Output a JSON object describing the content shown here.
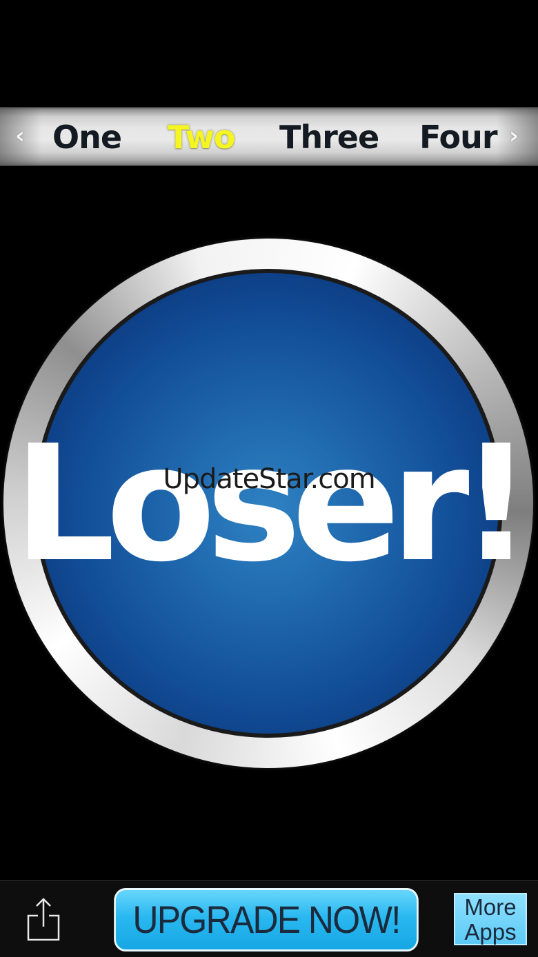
{
  "tabs": {
    "items": [
      "One",
      "Two",
      "Three",
      "Four"
    ],
    "selected_index": 1,
    "prev_arrow": "‹",
    "next_arrow": "›"
  },
  "main_button": {
    "label": "Loser!"
  },
  "watermark": "UpdateStar.com",
  "bottom_bar": {
    "share_icon": "share-icon",
    "upgrade_label": "UPGRADE NOW!",
    "more_apps_line1": "More",
    "more_apps_line2": "Apps"
  },
  "colors": {
    "selected_tab": "#f5f522",
    "tab_text": "#141a22",
    "button_face": "#1f67ad",
    "upgrade_button": "#2ab8f0"
  }
}
